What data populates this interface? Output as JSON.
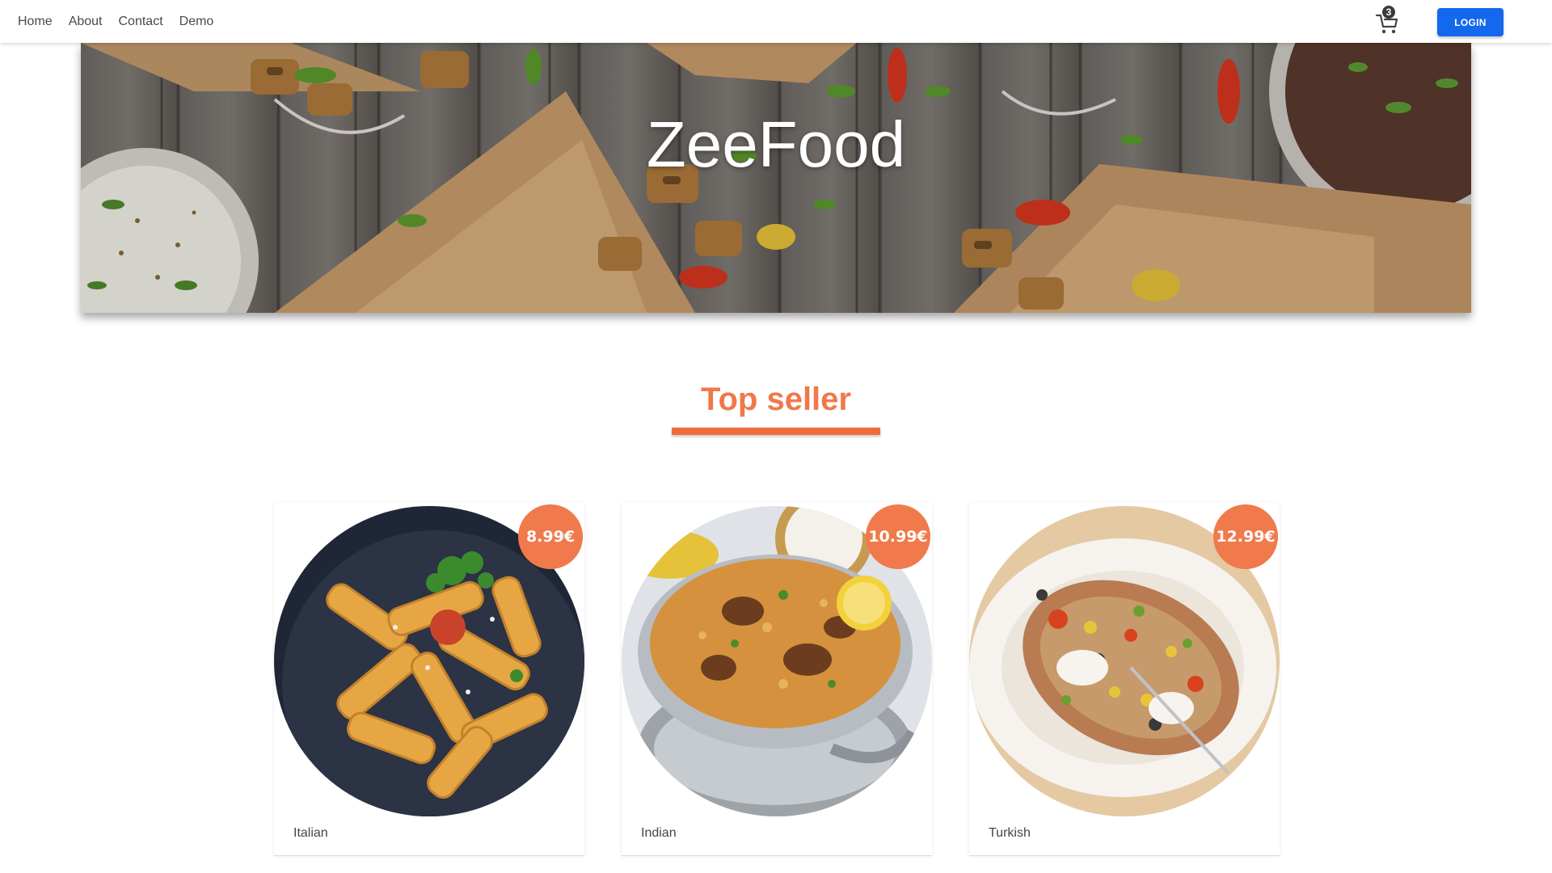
{
  "nav": {
    "links": [
      "Home",
      "About",
      "Contact",
      "Demo"
    ],
    "cart_count": "3",
    "login_label": "LOGIN"
  },
  "hero": {
    "title": "ZeeFood"
  },
  "section": {
    "title": "Top seller"
  },
  "products": [
    {
      "label": "Italian",
      "price": "8.99€"
    },
    {
      "label": "Indian",
      "price": "10.99€"
    },
    {
      "label": "Turkish",
      "price": "12.99€"
    }
  ],
  "colors": {
    "accent": "#f0784a",
    "login_button": "#1468ee"
  }
}
